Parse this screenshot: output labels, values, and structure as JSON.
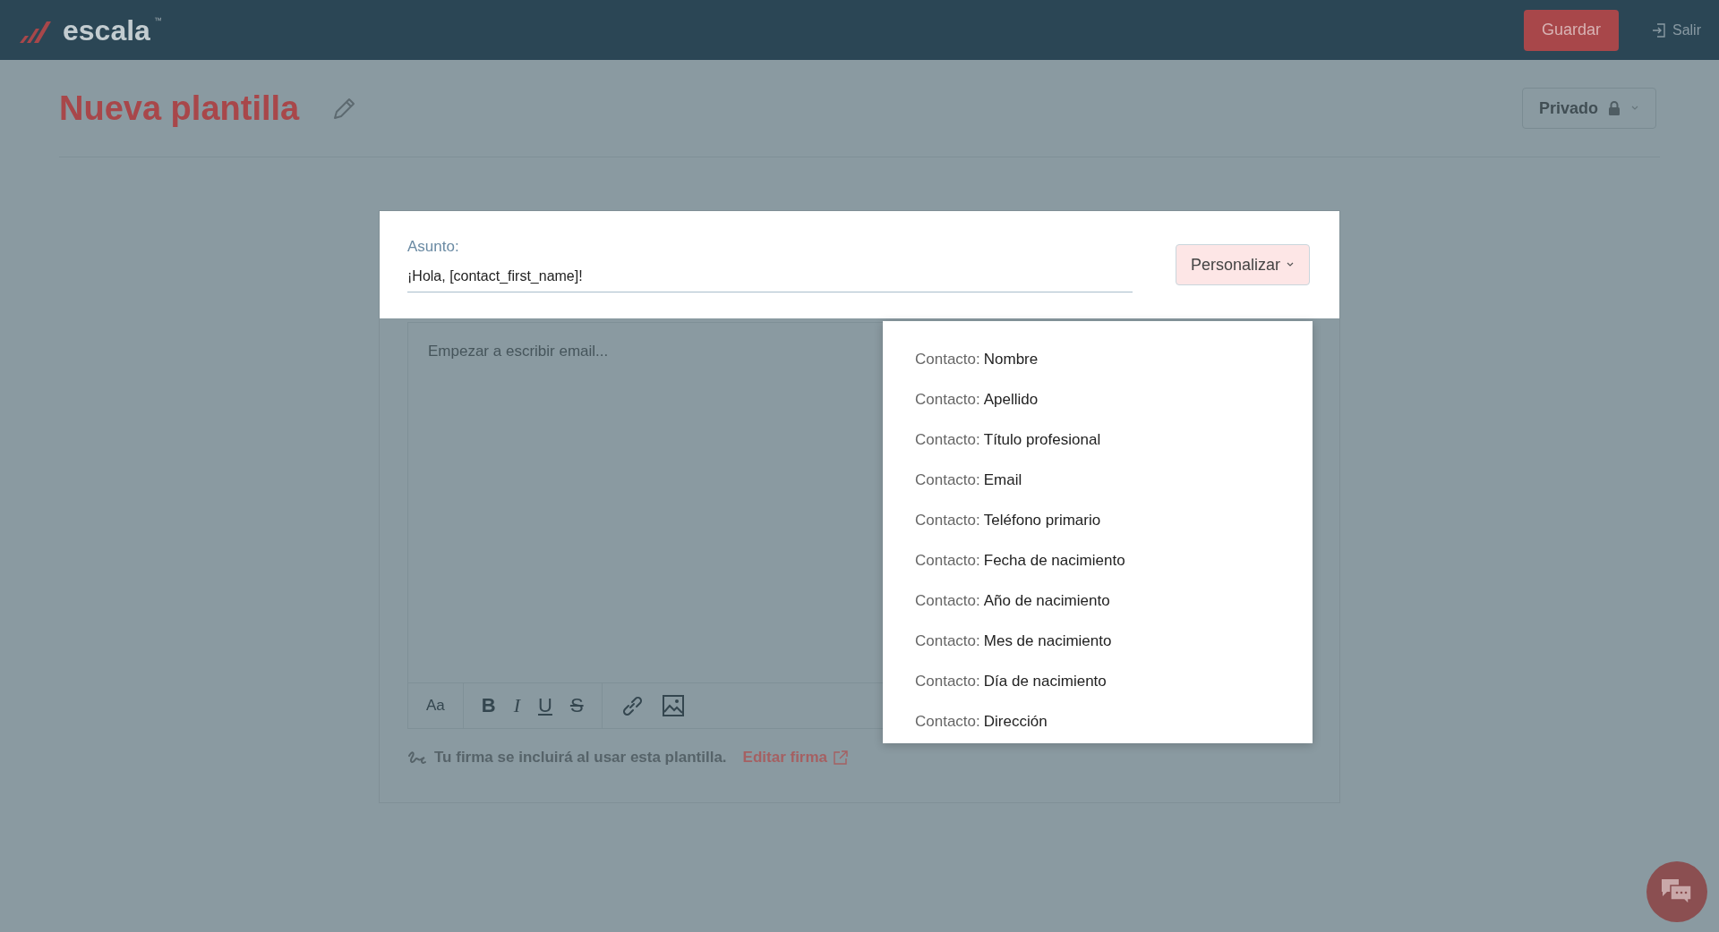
{
  "header": {
    "logo": "escala",
    "logo_mark": "™",
    "save_button": "Guardar",
    "exit_link": "Salir"
  },
  "page": {
    "title": "Nueva plantilla",
    "visibility": "Privado"
  },
  "subject": {
    "label": "Asunto:",
    "value": "¡Hola, [contact_first_name]!",
    "personalize_button": "Personalizar"
  },
  "editor": {
    "placeholder": "Empezar a escribir email...",
    "toolbar": [
      [
        {
          "kind": "size",
          "label": "Aa"
        }
      ],
      [
        {
          "kind": "bold",
          "label": "B"
        },
        {
          "kind": "italic",
          "label": "I"
        },
        {
          "kind": "underline",
          "label": "U"
        },
        {
          "kind": "strike",
          "label": "S"
        }
      ],
      [
        {
          "kind": "link"
        },
        {
          "kind": "image"
        }
      ]
    ]
  },
  "signature": {
    "text": "Tu firma se incluirá al usar esta plantilla.",
    "link": "Editar firma"
  },
  "personalize_menu": [
    {
      "prefix": "Contacto:",
      "field": "Nombre"
    },
    {
      "prefix": "Contacto:",
      "field": "Apellido"
    },
    {
      "prefix": "Contacto:",
      "field": "Título profesional"
    },
    {
      "prefix": "Contacto:",
      "field": "Email"
    },
    {
      "prefix": "Contacto:",
      "field": "Teléfono primario"
    },
    {
      "prefix": "Contacto:",
      "field": "Fecha de nacimiento"
    },
    {
      "prefix": "Contacto:",
      "field": "Año de nacimiento"
    },
    {
      "prefix": "Contacto:",
      "field": "Mes de nacimiento"
    },
    {
      "prefix": "Contacto:",
      "field": "Día de nacimiento"
    },
    {
      "prefix": "Contacto:",
      "field": "Dirección"
    }
  ]
}
